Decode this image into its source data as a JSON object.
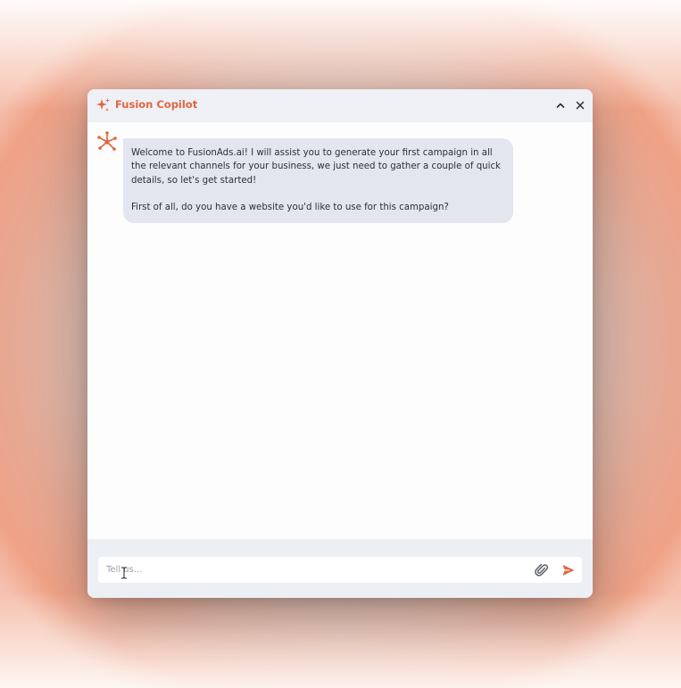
{
  "window": {
    "title": "Fusion Copilot",
    "header_icons": [
      "sparkle-icon",
      "chevron-up-icon",
      "close-icon"
    ]
  },
  "messages": [
    {
      "sender": "bot",
      "avatar_icon": "network-node-icon",
      "paragraphs": [
        "Welcome to FusionAds.ai! I will assist you to generate your first campaign in all the relevant channels for your business, we just need to gather a couple of quick details, so let's get started!",
        "First of all, do you have a website you'd like to use for this campaign?"
      ]
    }
  ],
  "composer": {
    "placeholder": "Tell us...",
    "value": "",
    "attach_icon": "paperclip-icon",
    "send_icon": "send-icon"
  },
  "colors": {
    "accent": "#e0653f",
    "header_bg": "#eef0f5",
    "bubble_bg": "#e3e6ee",
    "footer_bg": "#eceff4"
  }
}
